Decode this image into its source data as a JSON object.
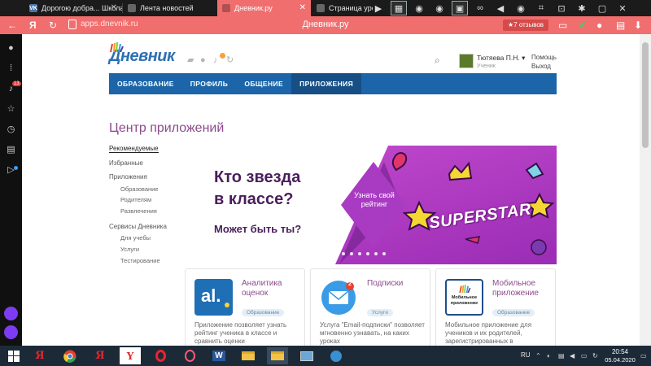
{
  "browser": {
    "tabs": [
      {
        "label": "Дорогою добра... Школа №",
        "icon": "vk-icon"
      },
      {
        "label": "Лента новостей",
        "icon": "dnevnik-icon"
      },
      {
        "label": "Дневник.ру",
        "icon": "dnevnik-icon"
      },
      {
        "label": "Страница урока",
        "icon": "dnevnik-icon"
      }
    ],
    "back": "←",
    "yandex_y": "Я",
    "url": "apps.dnevnik.ru",
    "page_title": "Дневник.ру",
    "reviews": "★7 отзывов"
  },
  "sidebar": {
    "notifications_badge": "13"
  },
  "header": {
    "logo": "Дневник",
    "user_name": "Тютяева П.Н. ▾",
    "user_role": "Ученик",
    "help": "Помощь",
    "logout": "Выход"
  },
  "nav": [
    "ОБРАЗОВАНИЕ",
    "ПРОФИЛЬ",
    "ОБЩЕНИЕ",
    "ПРИЛОЖЕНИЯ"
  ],
  "page_title": "Центр приложений",
  "leftnav": {
    "recommended": "Рекомендуемые",
    "favorites": "Избранные",
    "apps": "Приложения",
    "education": "Образование",
    "parents": "Родителям",
    "fun": "Развлечения",
    "services": "Сервисы Дневника",
    "for_school": "Для учебы",
    "services_sub": "Услуги",
    "testing": "Тестирование"
  },
  "banner": {
    "line1": "Кто звезда",
    "line2": "в классе?",
    "line3": "Может быть ты?",
    "cta": "Узнать свой рейтинг",
    "superstar": "SUPERSTAR"
  },
  "cards": [
    {
      "title": "Аналитика оценок",
      "tag": "Образование",
      "desc": "Приложение позволяет узнать рейтинг ученика в классе и сравнить оценки"
    },
    {
      "title": "Подписки",
      "tag": "Услуги",
      "desc": "Услуга \"Email-подписки\" позволяет мгновенно узнавать, на каких уроках"
    },
    {
      "title": "Мобильное приложение",
      "tag": "Образование",
      "desc": "Мобильное приложение для учеников и их родителей, зарегистрированных в"
    }
  ],
  "card_icons": {
    "analytics": "al.",
    "subs_badge": "2",
    "mobile": "Мобильное приложение"
  },
  "taskbar": {
    "lang": "RU",
    "time": "20:54",
    "date": "05.04.2020"
  }
}
